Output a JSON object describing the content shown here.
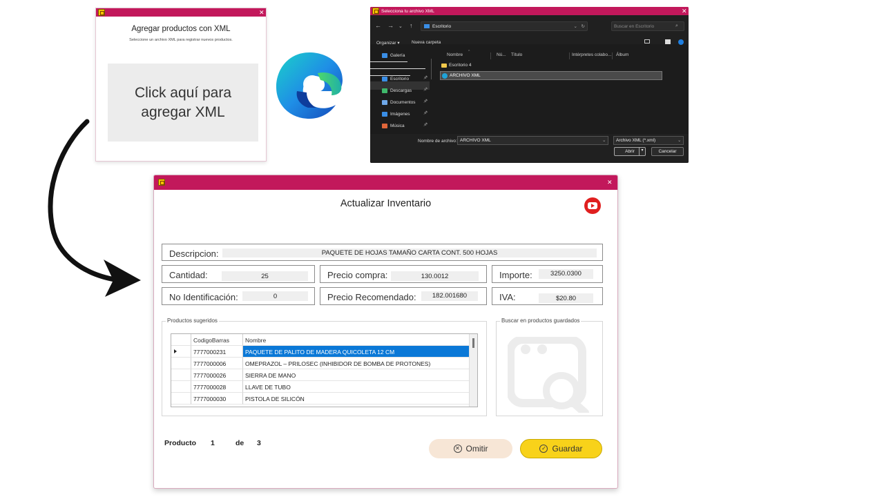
{
  "xml_window": {
    "title": "Agregar productos con XML",
    "subtitle": "Seleccione un archivo XML para registrar nuevos productos.",
    "drop_label": "Click aquí para agregar XML"
  },
  "file_dialog": {
    "title": "Selecciona tu archivo XML",
    "path": "Escritorio",
    "search_placeholder": "Buscar en Escritorio",
    "toolbar": {
      "organize": "Organizar ▾",
      "new_folder": "Nueva carpeta"
    },
    "sidebar": [
      {
        "label": "Galería",
        "icon": "gallery-icon",
        "color": "#3a8ee6"
      },
      {
        "label": "Escritorio",
        "icon": "desktop-icon",
        "color": "#3a8ee6"
      },
      {
        "label": "Descargas",
        "icon": "download-icon",
        "color": "#3fb86b"
      },
      {
        "label": "Documentos",
        "icon": "document-icon",
        "color": "#6fa8e8"
      },
      {
        "label": "Imágenes",
        "icon": "image-icon",
        "color": "#3a8ee6"
      },
      {
        "label": "Música",
        "icon": "music-icon",
        "color": "#e0663a"
      }
    ],
    "columns": [
      "Nombre",
      "Nú...",
      "Título",
      "Intérpretes colabo...",
      "Álbum"
    ],
    "files": [
      "Escritorio 4",
      "ARCHIVO XML"
    ],
    "filename_label": "Nombre de archivo:",
    "filename_value": "ARCHIVO XML",
    "filetype": "Archivo XML (*.xml)",
    "open_label": "Abrir",
    "cancel_label": "Cancelar"
  },
  "inventory": {
    "title": "Actualizar Inventario",
    "fields": {
      "descripcion": {
        "label": "Descripcion:",
        "value": "PAQUETE DE HOJAS TAMAÑO CARTA CONT. 500 HOJAS"
      },
      "cantidad": {
        "label": "Cantidad:",
        "value": "25"
      },
      "precio_compra": {
        "label": "Precio compra:",
        "value": "130.0012"
      },
      "importe": {
        "label": "Importe:",
        "value": "3250.0300"
      },
      "no_identificacion": {
        "label": "No Identificación:",
        "value": "0"
      },
      "precio_recomendado": {
        "label": "Precio Recomendado:",
        "value": "182.001680"
      },
      "iva": {
        "label": "IVA:",
        "value": "$20.80"
      }
    },
    "suggested_group": "Productos sugeridos",
    "search_group": "Buscar en productos guardados",
    "grid_headers": [
      "CodigoBarras",
      "Nombre"
    ],
    "grid_rows": [
      {
        "code": "7777000231",
        "name": "PAQUETE DE PALITO DE MADERA QUICOLETA 12 CM"
      },
      {
        "code": "7777000006",
        "name": "OMEPRAZOL – PRILOSEC (INHIBIDOR DE BOMBA DE PROTONES)"
      },
      {
        "code": "7777000026",
        "name": "SIERRA DE MANO"
      },
      {
        "code": "7777000028",
        "name": "LLAVE DE TUBO"
      },
      {
        "code": "7777000030",
        "name": "PISTOLA DE SILICÓN"
      }
    ],
    "pager": {
      "label": "Producto",
      "current": "1",
      "of": "de",
      "total": "3"
    },
    "omit_label": "Omitir",
    "save_label": "Guardar",
    "colors": {
      "accent": "#c2185b",
      "save": "#f8d21a",
      "omit": "#f7e6d6",
      "selection": "#0a78d7"
    }
  }
}
